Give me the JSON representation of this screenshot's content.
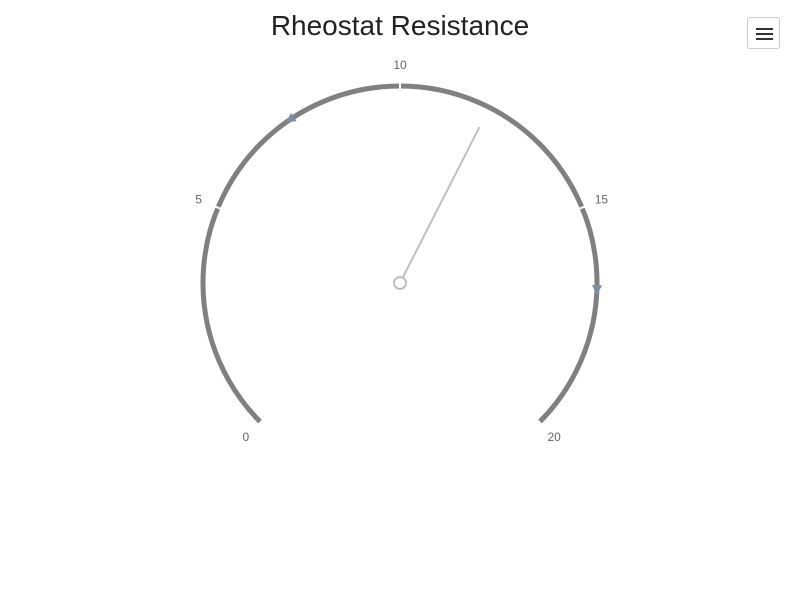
{
  "chart": {
    "title": "Rheostat Resistance",
    "menu_icon": "hamburger-menu-icon"
  },
  "chart_data": {
    "type": "gauge",
    "title": "Rheostat Resistance",
    "min": 0,
    "max": 20,
    "value": 12,
    "ticks": [
      "0",
      "5",
      "10",
      "15",
      "20"
    ],
    "tick_values": [
      0,
      5,
      10,
      15,
      20
    ],
    "markers": [
      7.5,
      16.8
    ],
    "colors": {
      "arc": "#808080",
      "needle": "#c0c0c0",
      "marker": "#7a8fa6",
      "tick_label": "#666666",
      "background": "#ffffff"
    }
  }
}
